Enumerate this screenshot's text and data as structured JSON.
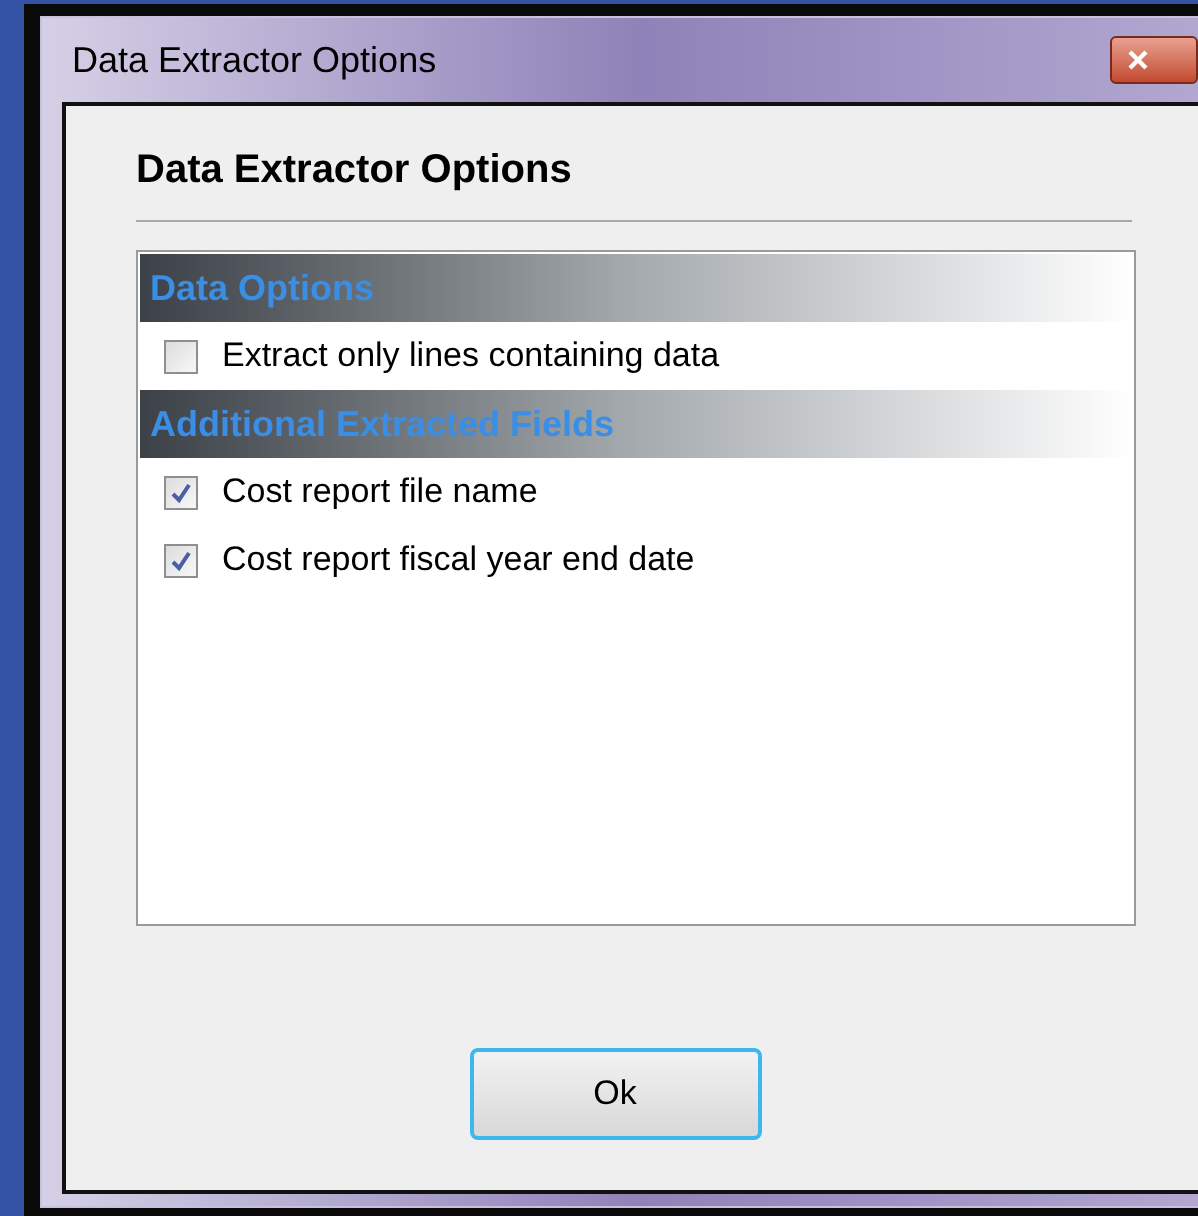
{
  "window": {
    "title": "Data Extractor Options"
  },
  "heading": "Data Extractor Options",
  "sections": [
    {
      "title": "Data Options",
      "options": [
        {
          "label": "Extract only lines containing data",
          "checked": false
        }
      ]
    },
    {
      "title": "Additional Extracted Fields",
      "options": [
        {
          "label": "Cost report file name",
          "checked": true
        },
        {
          "label": "Cost report fiscal year end date",
          "checked": true
        }
      ]
    }
  ],
  "buttons": [
    {
      "label": "Ok"
    }
  ]
}
